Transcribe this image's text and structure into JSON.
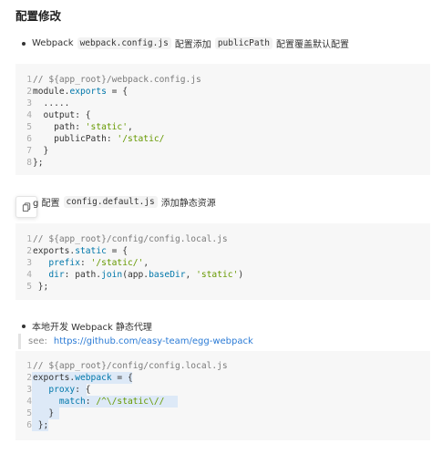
{
  "title": "配置修改",
  "section1": {
    "text_before": "Webpack",
    "code1": "webpack.config.js",
    "text_mid": "配置添加",
    "code2": "publicPath",
    "text_after": "配置覆盖默认配置"
  },
  "code_block1": [
    {
      "n": "1",
      "segments": [
        {
          "t": "// ${app_root}/webpack.config.js",
          "c": "cm"
        }
      ]
    },
    {
      "n": "2",
      "segments": [
        {
          "t": "module.",
          "c": ""
        },
        {
          "t": "exports",
          "c": "kw"
        },
        {
          "t": " = {",
          "c": ""
        }
      ]
    },
    {
      "n": "3",
      "segments": [
        {
          "t": "  .....",
          "c": ""
        }
      ]
    },
    {
      "n": "4",
      "segments": [
        {
          "t": "  output: {",
          "c": ""
        }
      ]
    },
    {
      "n": "5",
      "segments": [
        {
          "t": "    path: ",
          "c": ""
        },
        {
          "t": "'static'",
          "c": "str"
        },
        {
          "t": ",",
          "c": ""
        }
      ]
    },
    {
      "n": "6",
      "segments": [
        {
          "t": "    publicPath: ",
          "c": ""
        },
        {
          "t": "'/static/",
          "c": "str"
        }
      ]
    },
    {
      "n": "7",
      "segments": [
        {
          "t": "  }",
          "c": ""
        }
      ]
    },
    {
      "n": "8",
      "segments": [
        {
          "t": "};",
          "c": ""
        }
      ]
    }
  ],
  "section2": {
    "text_before": "g 配置",
    "code1": "config.default.js",
    "text_after": "添加静态资源"
  },
  "code_block2": [
    {
      "n": "1",
      "segments": [
        {
          "t": "// ${app_root}/config/config.local.js",
          "c": "cm"
        }
      ]
    },
    {
      "n": "2",
      "segments": [
        {
          "t": "exports.",
          "c": ""
        },
        {
          "t": "static",
          "c": "kw"
        },
        {
          "t": " = {",
          "c": ""
        }
      ]
    },
    {
      "n": "3",
      "segments": [
        {
          "t": "   prefix",
          "c": "kw"
        },
        {
          "t": ": ",
          "c": ""
        },
        {
          "t": "'/static/'",
          "c": "str"
        },
        {
          "t": ",",
          "c": ""
        }
      ]
    },
    {
      "n": "4",
      "segments": [
        {
          "t": "   dir",
          "c": "kw"
        },
        {
          "t": ": path.",
          "c": ""
        },
        {
          "t": "join",
          "c": "kw"
        },
        {
          "t": "(app.",
          "c": ""
        },
        {
          "t": "baseDir",
          "c": "kw"
        },
        {
          "t": ", ",
          "c": ""
        },
        {
          "t": "'static'",
          "c": "str"
        },
        {
          "t": ")",
          "c": ""
        }
      ]
    },
    {
      "n": "5",
      "segments": [
        {
          "t": " };",
          "c": ""
        }
      ]
    }
  ],
  "section3": {
    "text": "本地开发 Webpack 静态代理",
    "see_label": "see:",
    "see_link": "https://github.com/easy-team/egg-webpack"
  },
  "code_block3": [
    {
      "n": "1",
      "segments": [
        {
          "t": "// ${app_root}/config/config.local.js",
          "c": "cm"
        }
      ]
    },
    {
      "n": "2",
      "segments": [
        {
          "t": "exports.",
          "c": ""
        },
        {
          "t": "webpack",
          "c": "kw"
        },
        {
          "t": " = {",
          "c": ""
        }
      ]
    },
    {
      "n": "3",
      "segments": [
        {
          "t": "   proxy",
          "c": "kw"
        },
        {
          "t": ": {",
          "c": ""
        }
      ]
    },
    {
      "n": "4",
      "segments": [
        {
          "t": "     match",
          "c": "kw"
        },
        {
          "t": ": ",
          "c": ""
        },
        {
          "t": "/^\\/static\\//",
          "c": "str"
        }
      ]
    },
    {
      "n": "5",
      "segments": [
        {
          "t": "   }",
          "c": ""
        }
      ]
    },
    {
      "n": "6",
      "segments": [
        {
          "t": " };",
          "c": ""
        }
      ]
    }
  ],
  "copy_icon": "copy-icon"
}
